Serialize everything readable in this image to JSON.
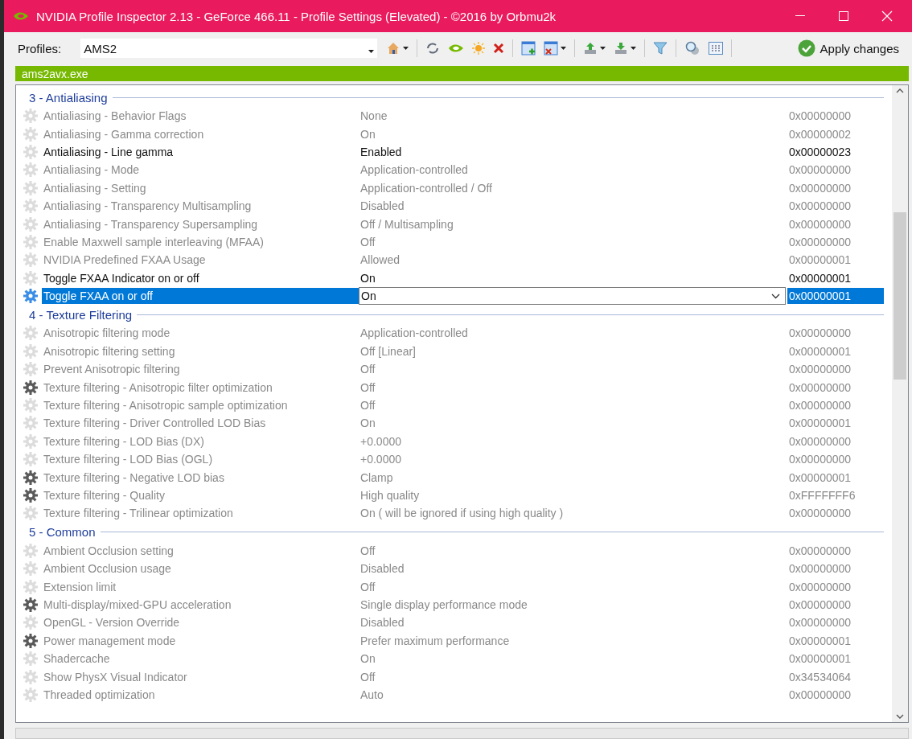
{
  "window": {
    "title": "NVIDIA Profile Inspector 2.13 - GeForce 466.11 - Profile Settings (Elevated) - ©2016 by Orbmu2k"
  },
  "toolbar": {
    "profiles_label": "Profiles:",
    "profile": "AMS2",
    "apply": "Apply changes"
  },
  "app_bar": "ams2avx.exe",
  "groups": [
    {
      "title": "3 - Antialiasing",
      "rows": [
        {
          "name": "Antialiasing - Behavior Flags",
          "value": "None",
          "hex": "0x00000000",
          "kind": "default",
          "modified": false,
          "selected": false
        },
        {
          "name": "Antialiasing - Gamma correction",
          "value": "On",
          "hex": "0x00000002",
          "kind": "default",
          "modified": false,
          "selected": false
        },
        {
          "name": "Antialiasing - Line gamma",
          "value": "Enabled",
          "hex": "0x00000023",
          "kind": "default",
          "modified": true,
          "selected": false
        },
        {
          "name": "Antialiasing - Mode",
          "value": "Application-controlled",
          "hex": "0x00000000",
          "kind": "default",
          "modified": false,
          "selected": false
        },
        {
          "name": "Antialiasing - Setting",
          "value": "Application-controlled / Off",
          "hex": "0x00000000",
          "kind": "default",
          "modified": false,
          "selected": false
        },
        {
          "name": "Antialiasing - Transparency Multisampling",
          "value": "Disabled",
          "hex": "0x00000000",
          "kind": "default",
          "modified": false,
          "selected": false
        },
        {
          "name": "Antialiasing - Transparency Supersampling",
          "value": "Off / Multisampling",
          "hex": "0x00000000",
          "kind": "default",
          "modified": false,
          "selected": false
        },
        {
          "name": "Enable Maxwell sample interleaving (MFAA)",
          "value": "Off",
          "hex": "0x00000000",
          "kind": "default",
          "modified": false,
          "selected": false
        },
        {
          "name": "NVIDIA Predefined FXAA Usage",
          "value": "Allowed",
          "hex": "0x00000001",
          "kind": "default",
          "modified": false,
          "selected": false
        },
        {
          "name": "Toggle FXAA Indicator on or off",
          "value": "On",
          "hex": "0x00000001",
          "kind": "default",
          "modified": true,
          "selected": false
        },
        {
          "name": "Toggle FXAA on or off",
          "value": "On",
          "hex": "0x00000001",
          "kind": "default",
          "modified": true,
          "selected": true
        }
      ]
    },
    {
      "title": "4 - Texture Filtering",
      "rows": [
        {
          "name": "Anisotropic filtering mode",
          "value": "Application-controlled",
          "hex": "0x00000000",
          "kind": "default",
          "modified": false,
          "selected": false
        },
        {
          "name": "Anisotropic filtering setting",
          "value": "Off [Linear]",
          "hex": "0x00000001",
          "kind": "default",
          "modified": false,
          "selected": false
        },
        {
          "name": "Prevent Anisotropic filtering",
          "value": "Off",
          "hex": "0x00000000",
          "kind": "default",
          "modified": false,
          "selected": false
        },
        {
          "name": "Texture filtering - Anisotropic filter optimization",
          "value": "Off",
          "hex": "0x00000000",
          "kind": "driver",
          "modified": false,
          "selected": false
        },
        {
          "name": "Texture filtering - Anisotropic sample optimization",
          "value": "Off",
          "hex": "0x00000000",
          "kind": "default",
          "modified": false,
          "selected": false
        },
        {
          "name": "Texture filtering - Driver Controlled LOD Bias",
          "value": "On",
          "hex": "0x00000001",
          "kind": "default",
          "modified": false,
          "selected": false
        },
        {
          "name": "Texture filtering - LOD Bias (DX)",
          "value": "+0.0000",
          "hex": "0x00000000",
          "kind": "default",
          "modified": false,
          "selected": false
        },
        {
          "name": "Texture filtering - LOD Bias (OGL)",
          "value": "+0.0000",
          "hex": "0x00000000",
          "kind": "default",
          "modified": false,
          "selected": false
        },
        {
          "name": "Texture filtering - Negative LOD bias",
          "value": "Clamp",
          "hex": "0x00000001",
          "kind": "driver",
          "modified": false,
          "selected": false
        },
        {
          "name": "Texture filtering - Quality",
          "value": "High quality",
          "hex": "0xFFFFFFF6",
          "kind": "driver",
          "modified": false,
          "selected": false
        },
        {
          "name": "Texture filtering - Trilinear optimization",
          "value": "On ( will be ignored if using high quality )",
          "hex": "0x00000000",
          "kind": "default",
          "modified": false,
          "selected": false
        }
      ]
    },
    {
      "title": "5 - Common",
      "rows": [
        {
          "name": "Ambient Occlusion setting",
          "value": "Off",
          "hex": "0x00000000",
          "kind": "default",
          "modified": false,
          "selected": false
        },
        {
          "name": "Ambient Occlusion usage",
          "value": "Disabled",
          "hex": "0x00000000",
          "kind": "default",
          "modified": false,
          "selected": false
        },
        {
          "name": "Extension limit",
          "value": "Off",
          "hex": "0x00000000",
          "kind": "default",
          "modified": false,
          "selected": false
        },
        {
          "name": "Multi-display/mixed-GPU acceleration",
          "value": "Single display performance mode",
          "hex": "0x00000000",
          "kind": "driver",
          "modified": false,
          "selected": false
        },
        {
          "name": "OpenGL - Version Override",
          "value": "Disabled",
          "hex": "0x00000000",
          "kind": "default",
          "modified": false,
          "selected": false
        },
        {
          "name": "Power management mode",
          "value": "Prefer maximum performance",
          "hex": "0x00000001",
          "kind": "driver",
          "modified": false,
          "selected": false
        },
        {
          "name": "Shadercache",
          "value": "On",
          "hex": "0x00000001",
          "kind": "default",
          "modified": false,
          "selected": false
        },
        {
          "name": "Show PhysX Visual Indicator",
          "value": "Off",
          "hex": "0x34534064",
          "kind": "default",
          "modified": false,
          "selected": false
        },
        {
          "name": "Threaded optimization",
          "value": "Auto",
          "hex": "0x00000000",
          "kind": "default",
          "modified": false,
          "selected": false
        }
      ]
    }
  ]
}
